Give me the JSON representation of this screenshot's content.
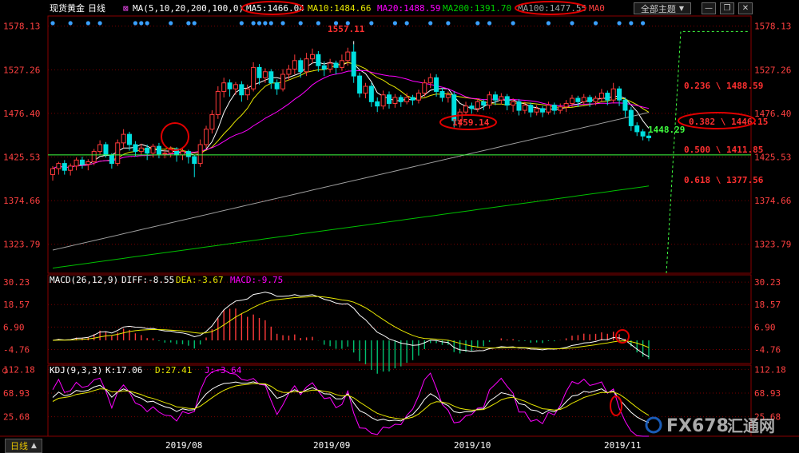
{
  "header": {
    "instrument": "现货黄金",
    "period": "日线",
    "ma_label": "MA(5,10,20,200,100,0)",
    "ma5": "MA5:1466.04",
    "ma10": "MA10:1484.66",
    "ma20": "MA20:1488.59",
    "ma200": "MA200:1391.70",
    "ma100": "MA100:1477.55",
    "ma0": "MA0",
    "theme_button": "全部主题",
    "theme_arrow": "▼"
  },
  "price_axis": {
    "labels": [
      "1578.13",
      "1527.26",
      "1476.40",
      "1425.53",
      "1374.66",
      "1323.79"
    ]
  },
  "annotations": {
    "high": "1557.11",
    "low": "1459.14",
    "last": "1448.29",
    "fib": [
      "0.236 \\ 1488.59",
      "0.382 \\ 1446.15",
      "0.500 \\ 1411.85",
      "0.618 \\ 1377.56"
    ]
  },
  "macd": {
    "label": "MACD(26,12,9)",
    "diff": "DIFF:-8.55",
    "dea": "DEA:-3.67",
    "macd": "MACD:-9.75",
    "axis": [
      "30.23",
      "18.57",
      "6.90",
      "-4.76"
    ]
  },
  "kdj": {
    "label": "KDJ(9,3,3)",
    "k": "K:17.06",
    "d": "D:27.41",
    "j": "J:-3.64",
    "axis": [
      "112.18",
      "68.93",
      "25.68"
    ]
  },
  "date_axis": [
    "2019/08",
    "2019/09",
    "2019/10",
    "2019/11"
  ],
  "bottom": {
    "period_tab": "日线"
  },
  "watermark": {
    "text": "FX678",
    "cn": "汇通网"
  },
  "colors": {
    "up": "#ff3a3a",
    "down": "#00e0e0",
    "ma5": "#ffffff",
    "ma10": "#e6e600",
    "ma20": "#ff00ff",
    "ma100": "#a0a0a0",
    "ma200": "#00c000",
    "fib": "#ff2020",
    "circle": "#e00000",
    "grid": "#7a0000",
    "axis_text": "#ff4040"
  },
  "chart_data": {
    "type": "candlestick",
    "ylim": [
      1290,
      1590
    ],
    "candles": [
      [
        1405,
        1412,
        1398,
        1415
      ],
      [
        1412,
        1418,
        1405,
        1420
      ],
      [
        1418,
        1410,
        1405,
        1422
      ],
      [
        1410,
        1415,
        1404,
        1418
      ],
      [
        1415,
        1422,
        1410,
        1425
      ],
      [
        1422,
        1417,
        1412,
        1426
      ],
      [
        1417,
        1420,
        1410,
        1423
      ],
      [
        1420,
        1432,
        1416,
        1435
      ],
      [
        1432,
        1440,
        1428,
        1445
      ],
      [
        1440,
        1428,
        1425,
        1443
      ],
      [
        1428,
        1418,
        1412,
        1430
      ],
      [
        1418,
        1442,
        1415,
        1446
      ],
      [
        1442,
        1452,
        1436,
        1458
      ],
      [
        1452,
        1440,
        1433,
        1455
      ],
      [
        1440,
        1432,
        1426,
        1444
      ],
      [
        1432,
        1436,
        1428,
        1441
      ],
      [
        1436,
        1430,
        1422,
        1440
      ],
      [
        1430,
        1438,
        1425,
        1441
      ],
      [
        1438,
        1429,
        1424,
        1442
      ],
      [
        1429,
        1430,
        1424,
        1434
      ],
      [
        1430,
        1435,
        1425,
        1438
      ],
      [
        1435,
        1428,
        1420,
        1437
      ],
      [
        1428,
        1432,
        1422,
        1436
      ],
      [
        1432,
        1426,
        1418,
        1434
      ],
      [
        1426,
        1418,
        1402,
        1428
      ],
      [
        1418,
        1440,
        1414,
        1446
      ],
      [
        1440,
        1458,
        1436,
        1462
      ],
      [
        1458,
        1475,
        1453,
        1480
      ],
      [
        1475,
        1502,
        1470,
        1508
      ],
      [
        1502,
        1512,
        1495,
        1518
      ],
      [
        1512,
        1505,
        1496,
        1516
      ],
      [
        1505,
        1510,
        1498,
        1513
      ],
      [
        1510,
        1498,
        1490,
        1514
      ],
      [
        1498,
        1505,
        1492,
        1510
      ],
      [
        1505,
        1530,
        1502,
        1536
      ],
      [
        1530,
        1518,
        1510,
        1534
      ],
      [
        1518,
        1525,
        1512,
        1529
      ],
      [
        1525,
        1512,
        1505,
        1528
      ],
      [
        1512,
        1505,
        1498,
        1516
      ],
      [
        1505,
        1522,
        1502,
        1528
      ],
      [
        1522,
        1528,
        1515,
        1533
      ],
      [
        1528,
        1538,
        1522,
        1545
      ],
      [
        1538,
        1525,
        1518,
        1541
      ],
      [
        1525,
        1540,
        1520,
        1547
      ],
      [
        1540,
        1545,
        1535,
        1552
      ],
      [
        1545,
        1532,
        1525,
        1549
      ],
      [
        1532,
        1528,
        1520,
        1537
      ],
      [
        1528,
        1535,
        1524,
        1540
      ],
      [
        1535,
        1530,
        1522,
        1538
      ],
      [
        1530,
        1538,
        1526,
        1545
      ],
      [
        1538,
        1548,
        1532,
        1553
      ],
      [
        1548,
        1520,
        1512,
        1557
      ],
      [
        1520,
        1500,
        1495,
        1524
      ],
      [
        1500,
        1508,
        1494,
        1512
      ],
      [
        1508,
        1490,
        1484,
        1512
      ],
      [
        1490,
        1485,
        1478,
        1495
      ],
      [
        1485,
        1498,
        1481,
        1503
      ],
      [
        1498,
        1488,
        1482,
        1502
      ],
      [
        1488,
        1495,
        1483,
        1499
      ],
      [
        1495,
        1490,
        1484,
        1498
      ],
      [
        1490,
        1495,
        1487,
        1500
      ],
      [
        1495,
        1492,
        1486,
        1498
      ],
      [
        1492,
        1500,
        1488,
        1504
      ],
      [
        1500,
        1512,
        1496,
        1516
      ],
      [
        1512,
        1518,
        1506,
        1523
      ],
      [
        1518,
        1502,
        1496,
        1522
      ],
      [
        1502,
        1495,
        1490,
        1506
      ],
      [
        1495,
        1498,
        1489,
        1502
      ],
      [
        1498,
        1468,
        1460,
        1502
      ],
      [
        1468,
        1478,
        1460,
        1482
      ],
      [
        1478,
        1485,
        1474,
        1490
      ],
      [
        1485,
        1482,
        1476,
        1489
      ],
      [
        1482,
        1490,
        1478,
        1494
      ],
      [
        1490,
        1486,
        1480,
        1493
      ],
      [
        1486,
        1498,
        1482,
        1502
      ],
      [
        1498,
        1492,
        1486,
        1502
      ],
      [
        1492,
        1496,
        1487,
        1500
      ],
      [
        1496,
        1486,
        1480,
        1499
      ],
      [
        1486,
        1490,
        1478,
        1494
      ],
      [
        1490,
        1480,
        1474,
        1493
      ],
      [
        1480,
        1486,
        1476,
        1490
      ],
      [
        1486,
        1478,
        1472,
        1489
      ],
      [
        1478,
        1482,
        1474,
        1486
      ],
      [
        1482,
        1478,
        1472,
        1485
      ],
      [
        1478,
        1486,
        1475,
        1490
      ],
      [
        1486,
        1480,
        1475,
        1489
      ],
      [
        1480,
        1484,
        1476,
        1488
      ],
      [
        1484,
        1488,
        1478,
        1492
      ],
      [
        1488,
        1494,
        1484,
        1498
      ],
      [
        1494,
        1490,
        1484,
        1497
      ],
      [
        1490,
        1495,
        1486,
        1499
      ],
      [
        1495,
        1490,
        1484,
        1498
      ],
      [
        1490,
        1494,
        1486,
        1497
      ],
      [
        1494,
        1500,
        1490,
        1505
      ],
      [
        1500,
        1492,
        1486,
        1503
      ],
      [
        1492,
        1505,
        1488,
        1512
      ],
      [
        1505,
        1492,
        1485,
        1508
      ],
      [
        1492,
        1480,
        1472,
        1495
      ],
      [
        1480,
        1462,
        1456,
        1484
      ],
      [
        1462,
        1455,
        1450,
        1466
      ],
      [
        1455,
        1450,
        1445,
        1458
      ],
      [
        1450,
        1448,
        1444,
        1455
      ]
    ],
    "ma5_last": 1466.04,
    "ma10_last": 1484.66,
    "ma20_last": 1488.59,
    "ma100_last": 1477.55,
    "ma200_last": 1391.7
  }
}
